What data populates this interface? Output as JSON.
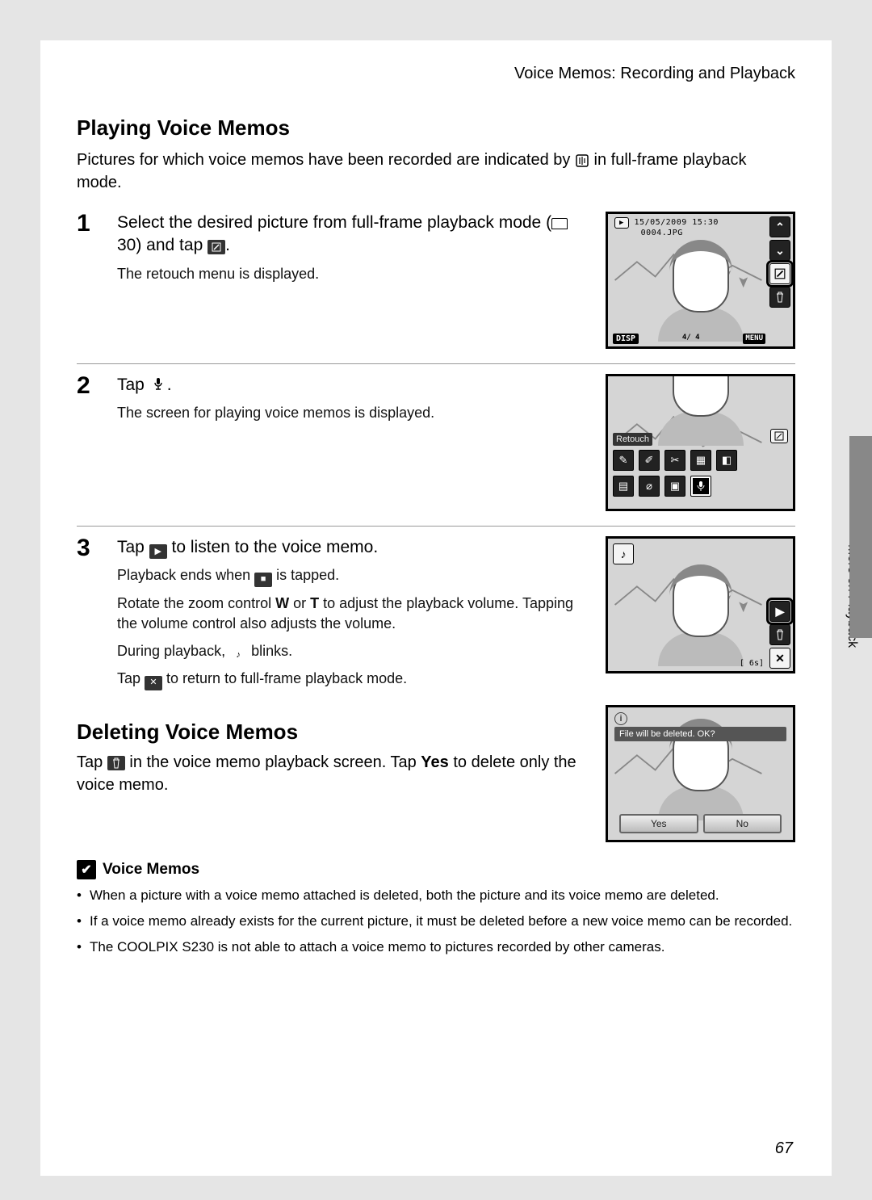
{
  "header": {
    "breadcrumb": "Voice Memos: Recording and Playback"
  },
  "section1": {
    "title": "Playing Voice Memos",
    "intro_a": "Pictures for which voice memos have been recorded are indicated by ",
    "intro_b": " in full-frame playback mode."
  },
  "step1": {
    "num": "1",
    "title_a": "Select the desired picture from full-frame playback mode (",
    "title_ref": " 30) and tap ",
    "title_c": ".",
    "desc": "The retouch menu is displayed.",
    "screen": {
      "date": "15/05/2009 15:30",
      "file": "0004.JPG",
      "counter": "4/    4",
      "disp": "DISP",
      "menu": "MENU"
    }
  },
  "step2": {
    "num": "2",
    "title_a": "Tap ",
    "title_b": ".",
    "desc": "The screen for playing voice memos is displayed.",
    "screen": {
      "retouch_label": "Retouch"
    }
  },
  "step3": {
    "num": "3",
    "line1_a": "Tap ",
    "line1_b": " to listen to the voice memo.",
    "d1_a": "Playback ends when ",
    "d1_b": " is tapped.",
    "d2_a": "Rotate the zoom control ",
    "d2_w": "W",
    "d2_mid": " or ",
    "d2_t": "T",
    "d2_b": " to adjust the playback volume. Tapping the volume control also adjusts the volume.",
    "d3_a": "During playback, ",
    "d3_b": " blinks.",
    "d4_a": "Tap ",
    "d4_b": " to return to full-frame playback mode.",
    "screen": {
      "time": "6s"
    }
  },
  "section2": {
    "title": "Deleting Voice Memos",
    "p_a": "Tap ",
    "p_b": " in the voice memo playback screen. Tap ",
    "p_yes": "Yes",
    "p_c": " to delete only the voice memo.",
    "screen": {
      "msg": "File will be deleted. OK?",
      "yes": "Yes",
      "no": "No"
    }
  },
  "side_tab": "More on Playback",
  "notes": {
    "head": "Voice Memos",
    "items": [
      "When a picture with a voice memo attached is deleted, both the picture and its voice memo are deleted.",
      "If a voice memo already exists for the current picture, it must be deleted before a new voice memo can be recorded.",
      "The COOLPIX S230 is not able to attach a voice memo to pictures recorded by other cameras."
    ]
  },
  "page_number": "67"
}
